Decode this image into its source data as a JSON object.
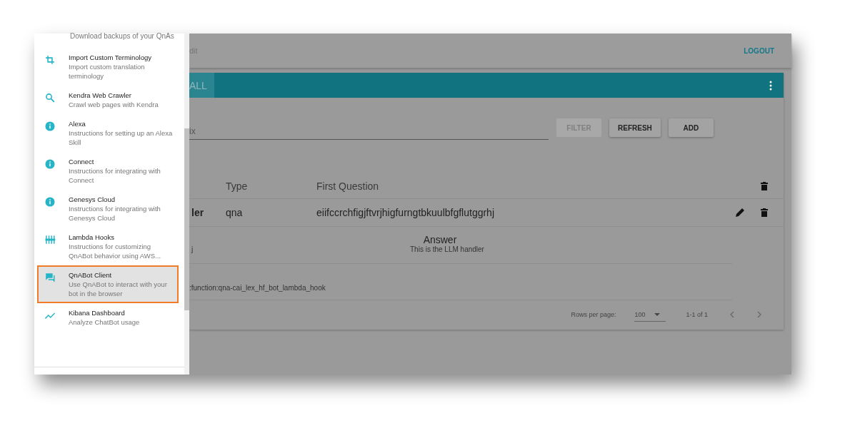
{
  "drawer": {
    "partial_item": {
      "description": "Download backups of your QnAs"
    },
    "items": [
      {
        "title": "Import Custom Terminology",
        "description": "Import custom translation terminology",
        "selected": false
      },
      {
        "title": "Kendra Web Crawler",
        "description": "Crawl web pages with Kendra",
        "selected": false
      },
      {
        "title": "Alexa",
        "description": "Instructions for setting up an Alexa Skill",
        "selected": false
      },
      {
        "title": "Connect",
        "description": "Instructions for integrating with Connect",
        "selected": false
      },
      {
        "title": "Genesys Cloud",
        "description": "Instructions for integrating with Genesys Cloud",
        "selected": false
      },
      {
        "title": "Lambda Hooks",
        "description": "Instructions for customizing QnABot behavior using AWS...",
        "selected": false
      },
      {
        "title": "QnABot Client",
        "description": "Use QnABot to interact with your bot in the browser",
        "selected": true
      },
      {
        "title": "Kibana Dashboard",
        "description": "Analyze ChatBot usage",
        "selected": false
      }
    ]
  },
  "toolbar": {
    "title_fragment": "dit",
    "logout": "LOGOUT"
  },
  "card": {
    "tab": "ALL",
    "filter": {
      "value": "ix"
    },
    "buttons": [
      {
        "label": "FILTER",
        "disabled": true
      },
      {
        "label": "REFRESH",
        "disabled": false
      },
      {
        "label": "ADD",
        "disabled": false
      }
    ],
    "table": {
      "columns": [
        "Type",
        "First Question"
      ],
      "rows": [
        {
          "column_1": "ler",
          "type": "qna",
          "question": "eiifccrchfigjftvrjhigfurngtbkuulbfgflutggrhj"
        }
      ]
    },
    "details": {
      "left_fragment": "j",
      "answer_heading": "Answer",
      "answer": "This is the LLM handler",
      "hook": ":function:qna-cai_lex_hf_bot_lambda_hook"
    },
    "footer": {
      "rows_label": "Rows per page:",
      "rows_value": "100",
      "range": "1-1 of 1"
    }
  }
}
